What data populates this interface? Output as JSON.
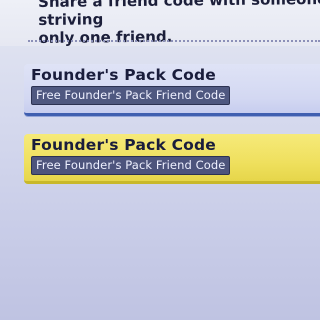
{
  "description": {
    "line1": "Share a friend code with someone striving",
    "line2": "only one friend."
  },
  "codes": [
    {
      "title": "Founder's Pack Code",
      "code_label": "Free Founder's Pack Friend Code",
      "state": "default",
      "accent": "#3f5fb0"
    },
    {
      "title": "Founder's Pack Code",
      "code_label": "Free Founder's Pack Friend Code",
      "state": "selected",
      "accent": "#efe05e"
    }
  ]
}
